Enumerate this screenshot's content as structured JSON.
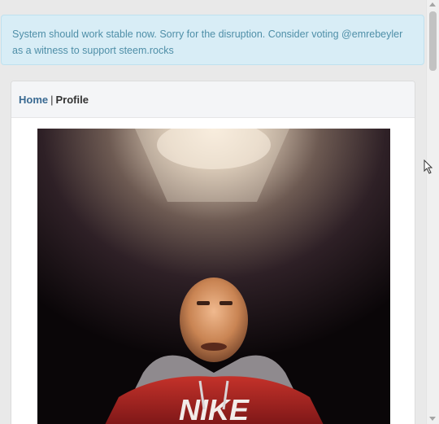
{
  "notice": {
    "text": "System should work stable now. Sorry for the disruption. Consider voting @emrebeyler as a witness to support steem.rocks"
  },
  "breadcrumb": {
    "home_label": "Home",
    "separator": "|",
    "current_label": "Profile"
  },
  "profile": {
    "photo_description_icon": "profile-photo"
  },
  "colors": {
    "notice_bg": "#d8edf6",
    "notice_text": "#4f8fa8",
    "link": "#3a6a92",
    "panel_heading_bg": "#f4f5f7"
  }
}
